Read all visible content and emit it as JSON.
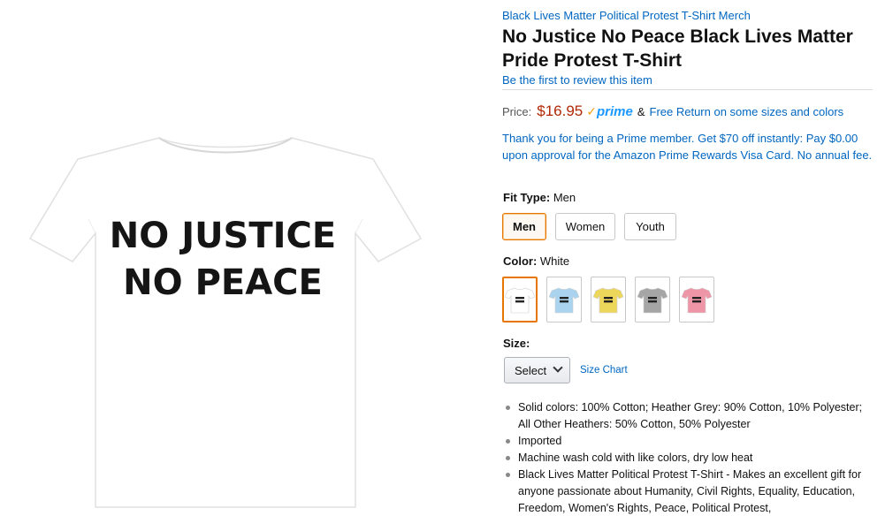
{
  "product_image": {
    "shirt_color": "#ffffff",
    "print_line1": "NO JUSTICE",
    "print_line2": "NO PEACE",
    "print_color": "#151515"
  },
  "brand_link": "Black Lives Matter Political Protest T-Shirt Merch",
  "title": "No Justice No Peace Black Lives Matter Pride Protest T-Shirt",
  "review_link": "Be the first to review this item",
  "price": {
    "label": "Price:",
    "value": "$16.95",
    "prime_label": "prime",
    "amp": "&",
    "free_return": "Free Return on some sizes and colors"
  },
  "promo": "Thank you for being a Prime member. Get $70 off instantly: Pay $0.00 upon approval for the Amazon Prime Rewards Visa Card. No annual fee.",
  "fit_type": {
    "label": "Fit Type:",
    "selected": "Men",
    "options": [
      "Men",
      "Women",
      "Youth"
    ]
  },
  "color": {
    "label": "Color:",
    "selected": "White",
    "swatches": [
      {
        "name": "White",
        "hex": "#ffffff"
      },
      {
        "name": "Baby Blue",
        "hex": "#a9d3ee"
      },
      {
        "name": "Lemon",
        "hex": "#ecd75a"
      },
      {
        "name": "Heather Grey",
        "hex": "#a5a5a5"
      },
      {
        "name": "Pink",
        "hex": "#ee95a8"
      }
    ]
  },
  "size": {
    "label": "Size:",
    "select_value": "Select",
    "size_chart": "Size Chart"
  },
  "bullets": [
    "Solid colors: 100% Cotton; Heather Grey: 90% Cotton, 10% Polyester; All Other Heathers: 50% Cotton, 50% Polyester",
    "Imported",
    "Machine wash cold with like colors, dry low heat",
    "Black Lives Matter Political Protest T-Shirt - Makes an excellent gift for anyone passionate about Humanity, Civil Rights, Equality, Education, Freedom, Women's Rights, Peace, Political Protest,"
  ],
  "colors": {
    "link": "#0066c0",
    "price": "#b12704",
    "prime": "#1a98ff",
    "selected_border": "#e77600"
  }
}
